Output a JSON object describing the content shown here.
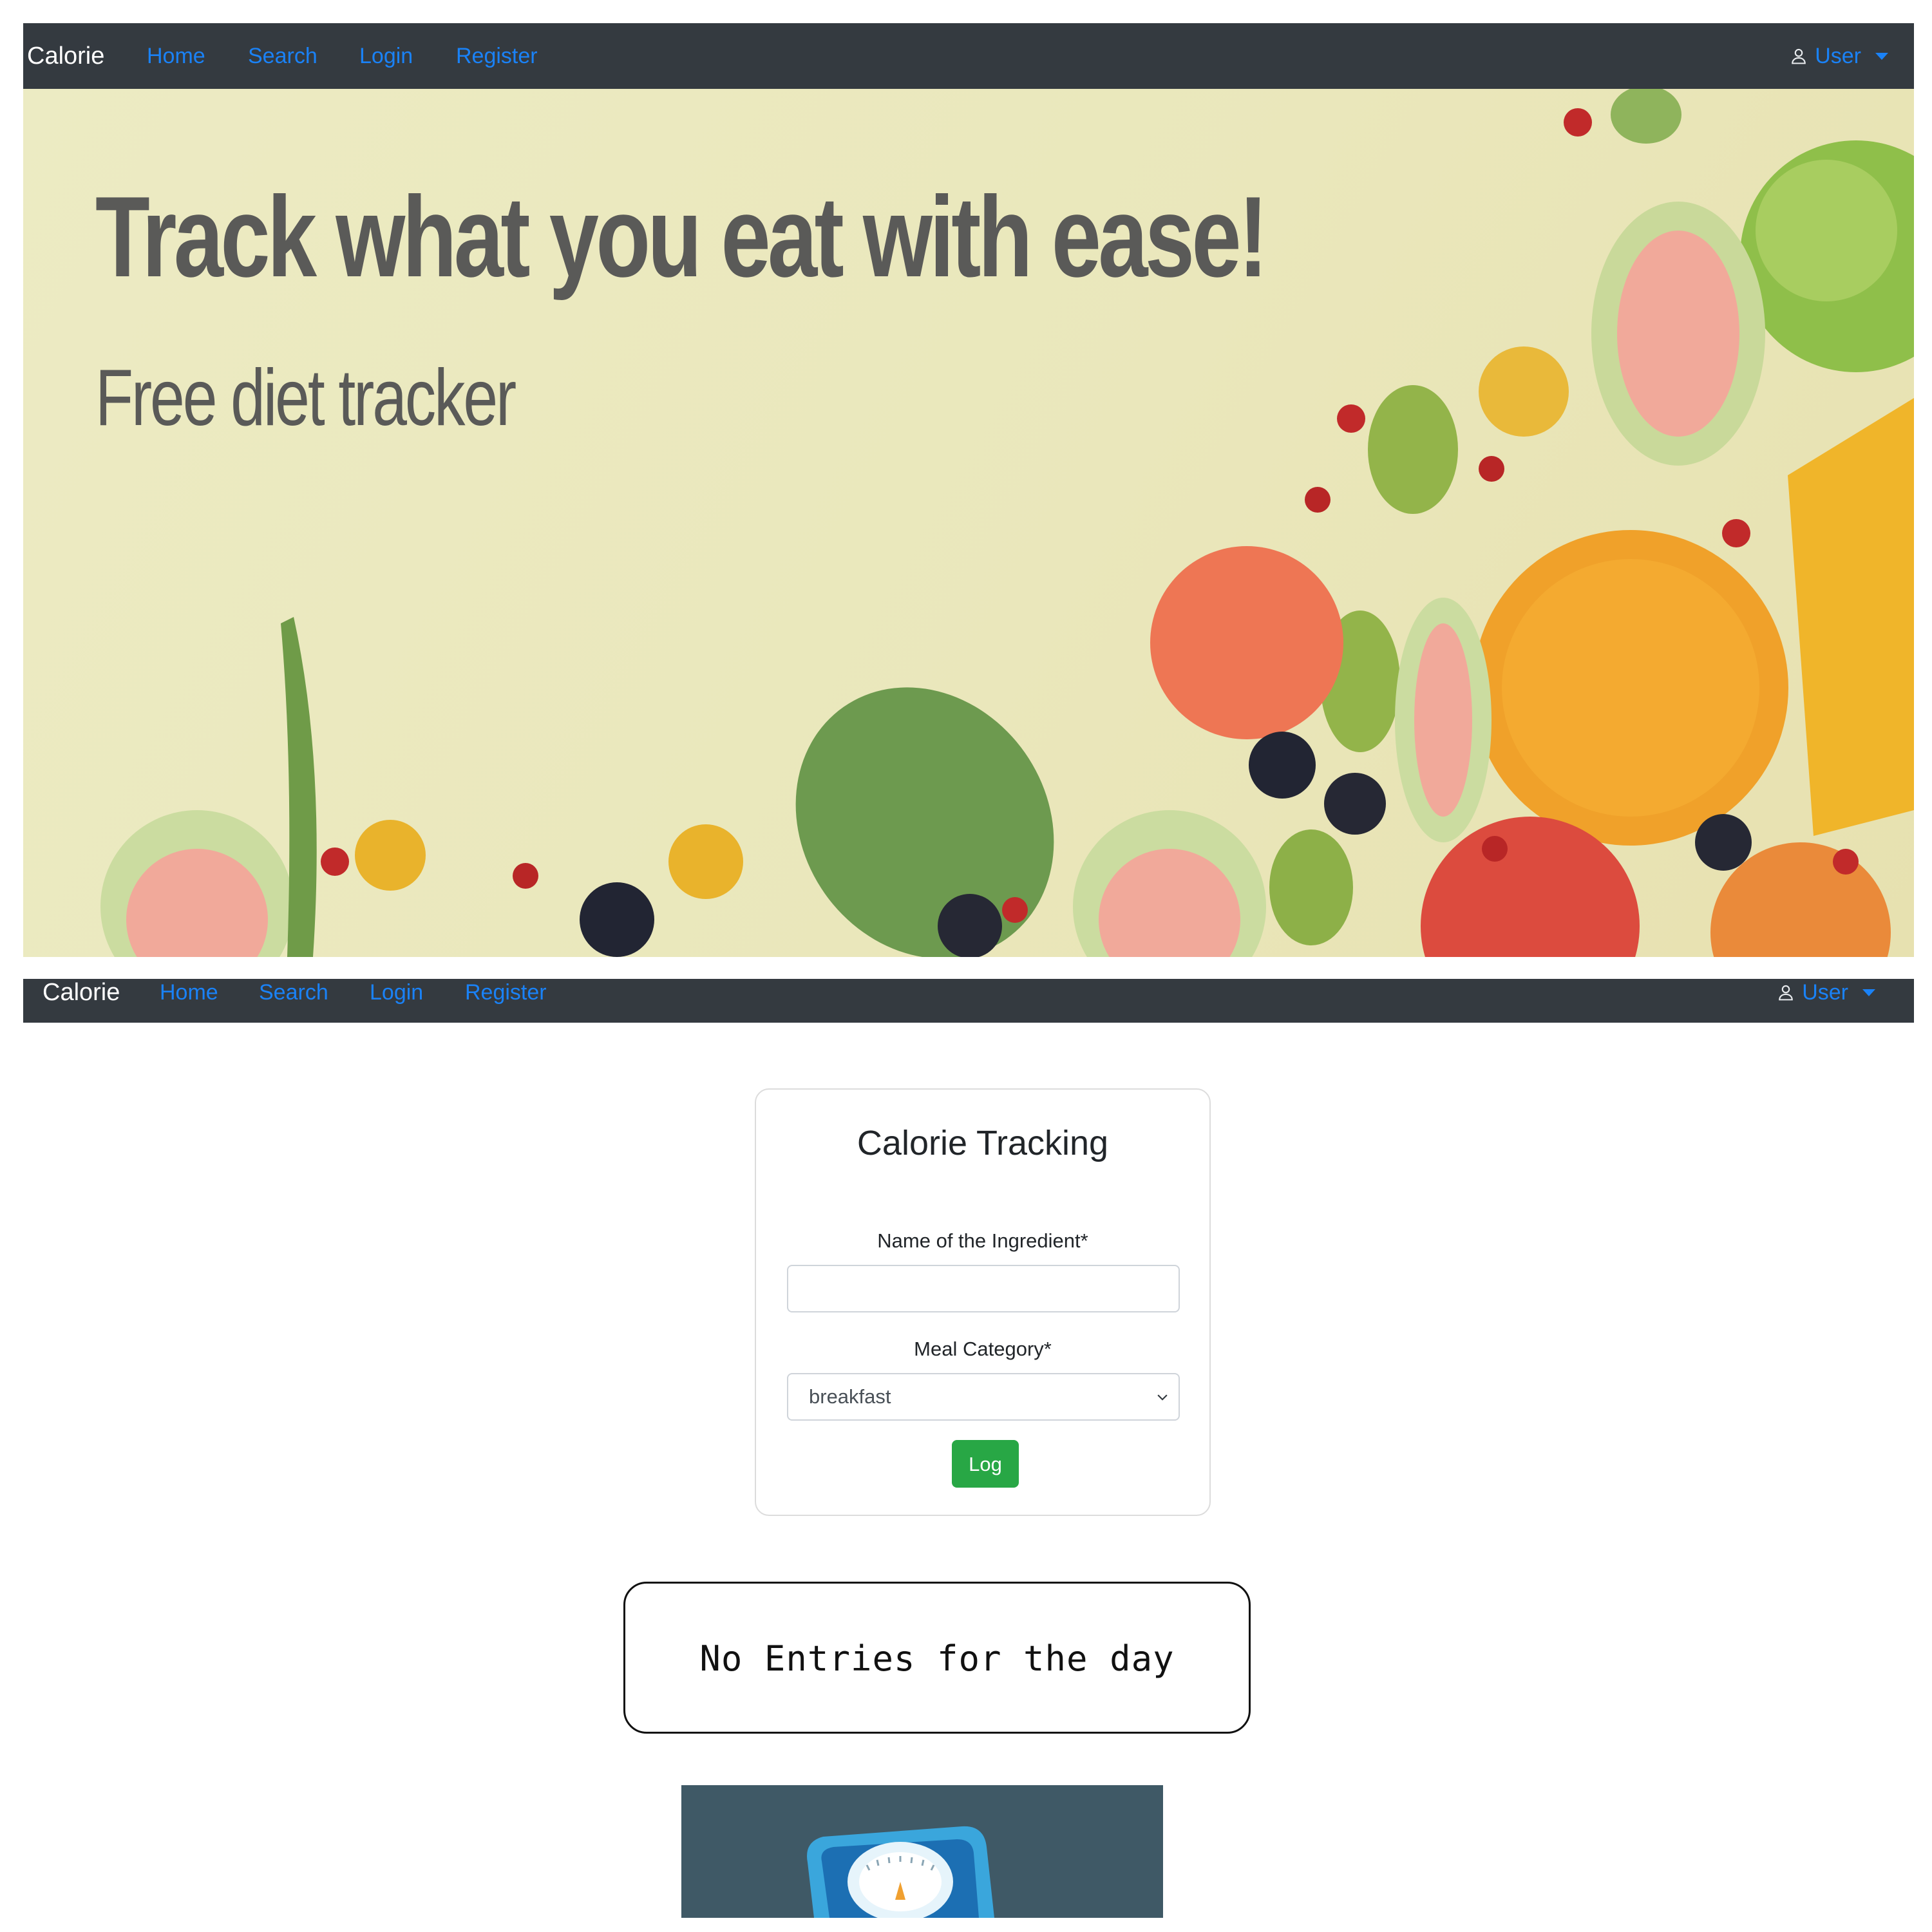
{
  "navbar": {
    "brand": "Calorie",
    "links": [
      "Home",
      "Search",
      "Login",
      "Register"
    ],
    "user_menu": "User"
  },
  "hero": {
    "title": "Track what you eat with ease!",
    "subtitle": "Free diet tracker"
  },
  "form": {
    "title": "Calorie Tracking",
    "ingredient_label": "Name of the Ingredient*",
    "ingredient_value": "",
    "category_label": "Meal Category*",
    "category_selected": "breakfast",
    "submit_label": "Log"
  },
  "entries": {
    "empty_message": "No Entries for the day"
  },
  "colors": {
    "navbar_bg": "#343a40",
    "link": "#1a82f7",
    "success": "#28a745",
    "scale_bg": "#3f5966"
  }
}
